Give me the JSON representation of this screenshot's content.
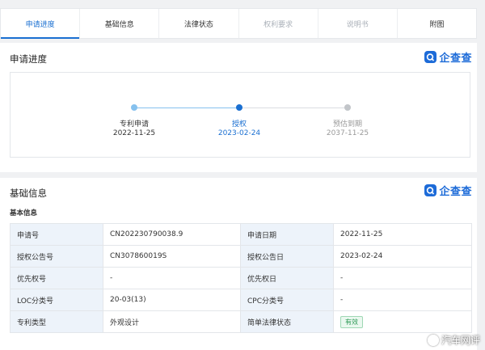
{
  "tabs": [
    {
      "label": "申请进度",
      "state": "active"
    },
    {
      "label": "基础信息",
      "state": "normal"
    },
    {
      "label": "法律状态",
      "state": "normal"
    },
    {
      "label": "权利要求",
      "state": "disabled"
    },
    {
      "label": "说明书",
      "state": "disabled"
    },
    {
      "label": "附图",
      "state": "normal"
    }
  ],
  "progress_section": {
    "title": "申请进度",
    "brand": "企查查",
    "steps": [
      {
        "label": "专利申请",
        "date": "2022-11-25",
        "status": "done"
      },
      {
        "label": "授权",
        "date": "2023-02-24",
        "status": "current"
      },
      {
        "label": "预估到期",
        "date": "2037-11-25",
        "status": "pending"
      }
    ]
  },
  "basic_section": {
    "title": "基础信息",
    "brand": "企查查",
    "subtitle": "基本信息",
    "rows": [
      [
        {
          "label": "申请号",
          "value": "CN202230790038.9"
        },
        {
          "label": "申请日期",
          "value": "2022-11-25"
        }
      ],
      [
        {
          "label": "授权公告号",
          "value": "CN307860019S"
        },
        {
          "label": "授权公告日",
          "value": "2023-02-24"
        }
      ],
      [
        {
          "label": "优先权号",
          "value": "-"
        },
        {
          "label": "优先权日",
          "value": "-"
        }
      ],
      [
        {
          "label": "LOC分类号",
          "value": "20-03(13)"
        },
        {
          "label": "CPC分类号",
          "value": "-"
        }
      ],
      [
        {
          "label": "专利类型",
          "value": "外观设计"
        },
        {
          "label": "简单法律状态",
          "value": "有效"
        }
      ]
    ]
  },
  "watermark": "汽车网评",
  "colors": {
    "accent": "#1a6fd1",
    "label_bg": "#edf3fa",
    "valid_green": "#2f9a57"
  }
}
